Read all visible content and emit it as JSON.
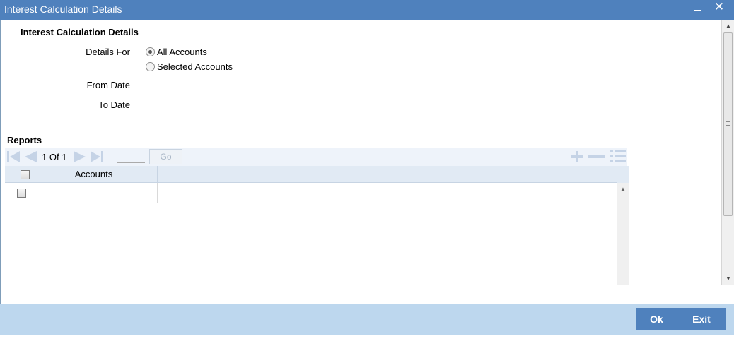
{
  "window": {
    "title": "Interest Calculation Details"
  },
  "form": {
    "section_title": "Interest Calculation Details",
    "details_for_label": "Details For",
    "options": [
      {
        "label": "All Accounts",
        "selected": true
      },
      {
        "label": "Selected Accounts",
        "selected": false
      }
    ],
    "from_date_label": "From Date",
    "from_date_value": "",
    "to_date_label": "To Date",
    "to_date_value": ""
  },
  "reports": {
    "title": "Reports",
    "pager": {
      "current": "1",
      "of_label": "Of",
      "total": "1",
      "go_label": "Go"
    },
    "columns": [
      "Accounts"
    ],
    "rows": [
      {
        "account": ""
      }
    ]
  },
  "footer": {
    "ok_label": "Ok",
    "exit_label": "Exit"
  },
  "colors": {
    "title_bar": "#4f81bd",
    "footer": "#bdd7ee",
    "button": "#4f81bd"
  }
}
